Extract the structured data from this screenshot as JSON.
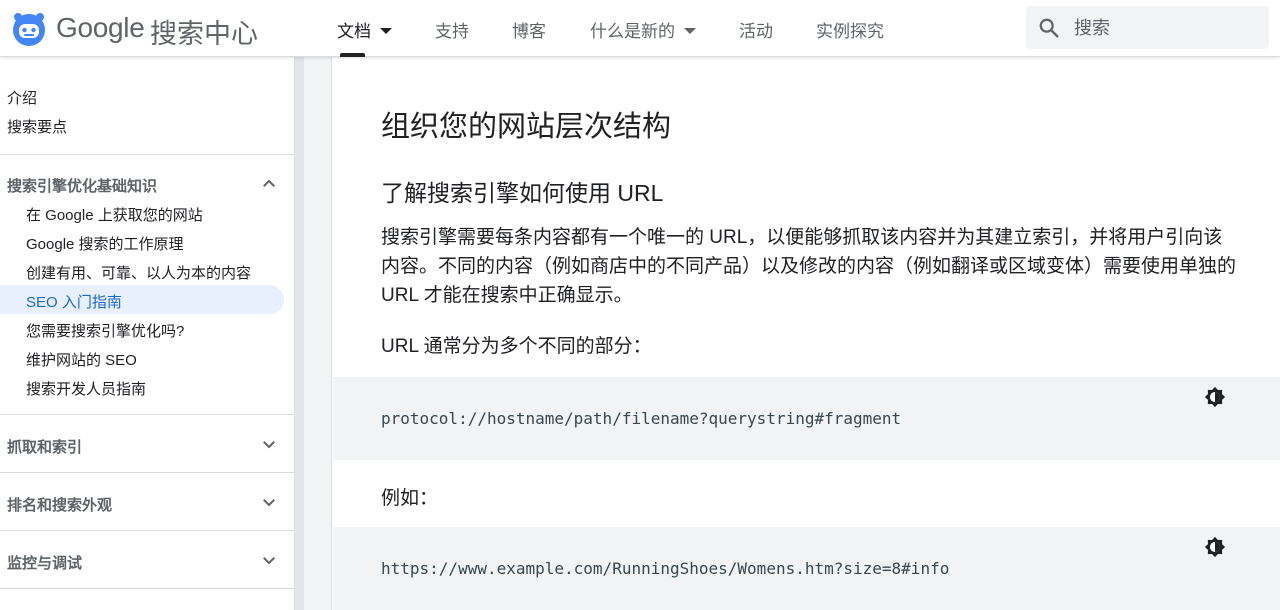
{
  "header": {
    "brand_google": "Google",
    "brand_product": "搜索中心",
    "tabs": [
      {
        "label": "文档",
        "active": true,
        "dropdown": true
      },
      {
        "label": "支持",
        "active": false,
        "dropdown": false
      },
      {
        "label": "博客",
        "active": false,
        "dropdown": false
      },
      {
        "label": "什么是新的",
        "active": false,
        "dropdown": true
      },
      {
        "label": "活动",
        "active": false,
        "dropdown": false
      },
      {
        "label": "实例探究",
        "active": false,
        "dropdown": false
      }
    ],
    "search": {
      "placeholder": "搜索",
      "icon": "search-icon"
    }
  },
  "sidebar": {
    "top_items": [
      "介绍",
      "搜索要点"
    ],
    "sections": [
      {
        "label": "搜索引擎优化基础知识",
        "expanded": true,
        "items": [
          {
            "label": "在 Google 上获取您的网站",
            "active": false
          },
          {
            "label": "Google 搜索的工作原理",
            "active": false
          },
          {
            "label": "创建有用、可靠、以人为本的内容",
            "active": false
          },
          {
            "label": "SEO 入门指南",
            "active": true
          },
          {
            "label": "您需要搜索引擎优化吗?",
            "active": false
          },
          {
            "label": "维护网站的 SEO",
            "active": false
          },
          {
            "label": "搜索开发人员指南",
            "active": false
          }
        ]
      },
      {
        "label": "抓取和索引",
        "expanded": false
      },
      {
        "label": "排名和搜索外观",
        "expanded": false
      },
      {
        "label": "监控与调试",
        "expanded": false
      }
    ]
  },
  "main": {
    "title": "组织您的网站层次结构",
    "subtitle": "了解搜索引擎如何使用 URL",
    "paragraph": "搜索引擎需要每条内容都有一个唯一的 URL，以便能够抓取该内容并为其建立索引，并将用户引向该内容。不同的内容（例如商店中的不同产品）以及修改的内容（例如翻译或区域变体）需要使用单独的 URL 才能在搜索中正确显示。",
    "url_intro": "URL 通常分为多个不同的部分：",
    "code1": "protocol://hostname/path/filename?querystring#fragment",
    "example_label": "例如：",
    "code2": "https://www.example.com/RunningShoes/Womens.htm?size=8#info"
  },
  "colors": {
    "accent": "#1967d2",
    "active_bg": "#e8f0fe",
    "code_bg": "#f1f3f4",
    "text": "#202124",
    "muted": "#5f6368"
  }
}
